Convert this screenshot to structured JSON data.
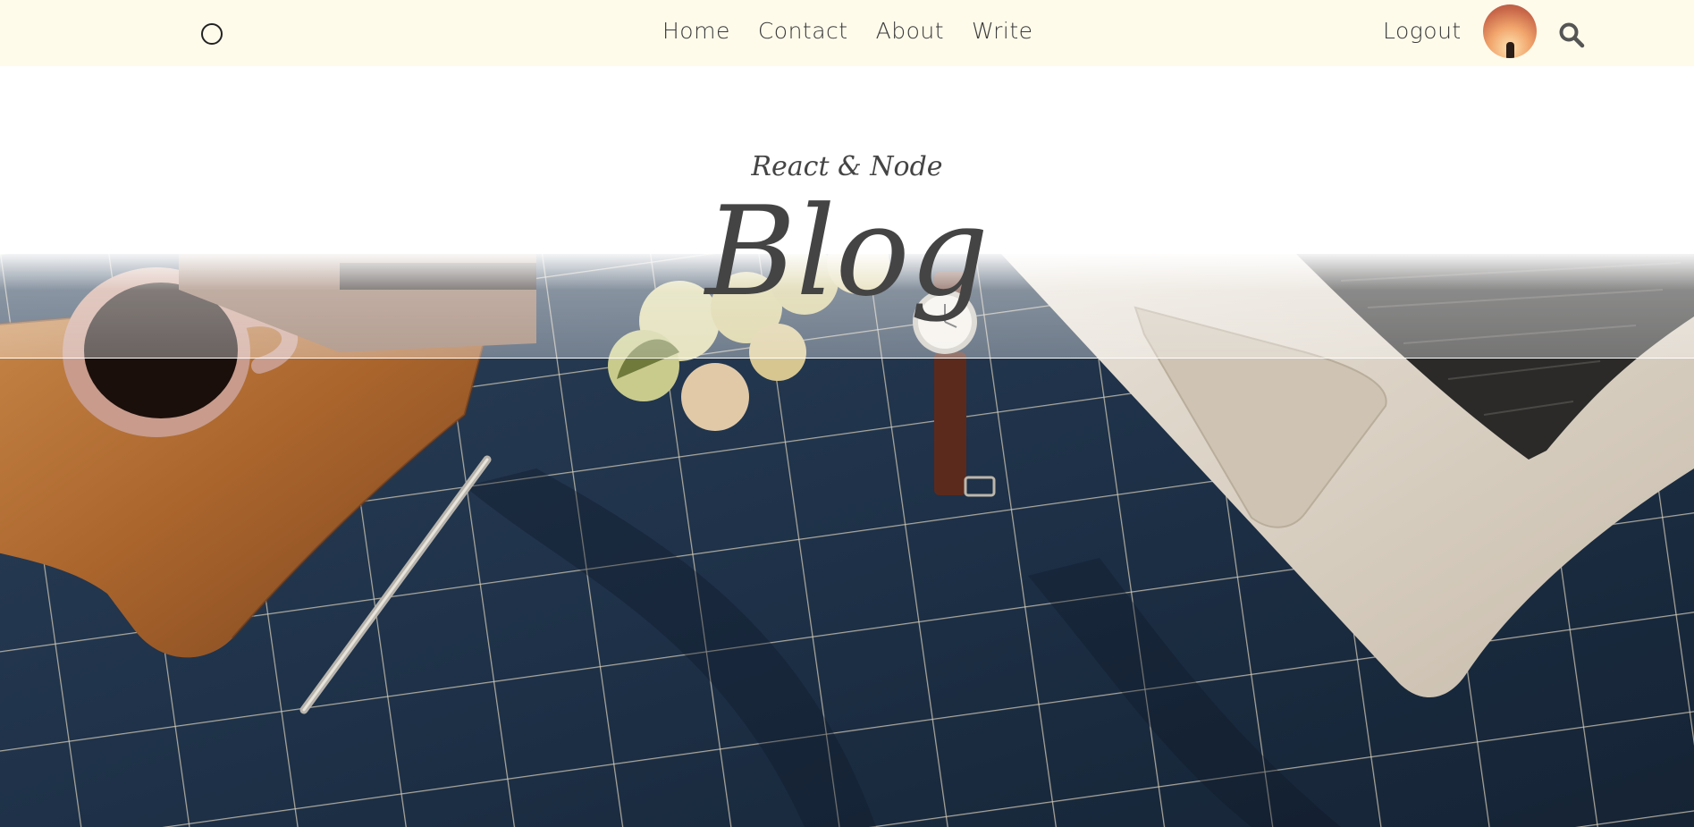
{
  "navbar": {
    "left_icon": "circle-icon",
    "menu": [
      {
        "label": "Home"
      },
      {
        "label": "Contact"
      },
      {
        "label": "About"
      },
      {
        "label": "Write"
      }
    ],
    "logout_label": "Logout",
    "avatar_icon": "avatar-image",
    "search_icon": "search-icon",
    "background_color": "#fffbeb"
  },
  "header": {
    "subtitle": "React & Node",
    "title": "Blog",
    "text_color": "#444444"
  },
  "hero": {
    "description_icon": "desk-flatlay-image"
  }
}
